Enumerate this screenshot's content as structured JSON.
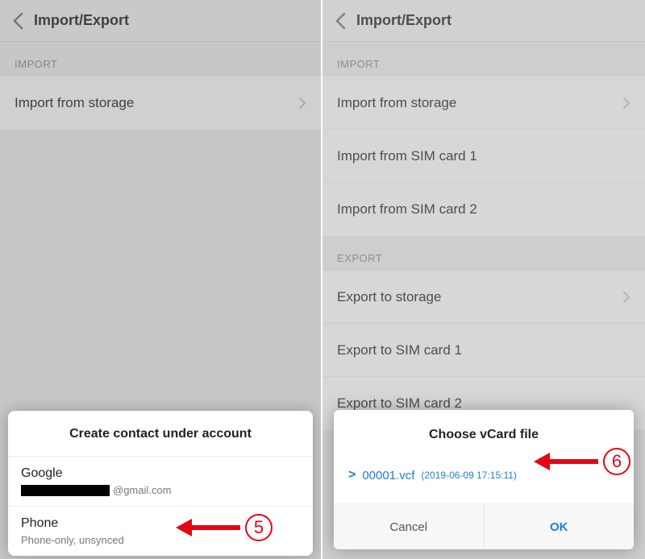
{
  "left": {
    "header": {
      "title": "Import/Export"
    },
    "section_import": "IMPORT",
    "rows": {
      "import_from_storage": "Import from storage"
    },
    "sheet": {
      "title": "Create contact under account",
      "google": {
        "name": "Google",
        "email_suffix": "@gmail.com"
      },
      "phone": {
        "name": "Phone",
        "sub": "Phone-only, unsynced"
      }
    },
    "annotation": {
      "num": "5"
    }
  },
  "right": {
    "header": {
      "title": "Import/Export"
    },
    "section_import": "IMPORT",
    "section_export": "EXPORT",
    "rows": {
      "import_from_storage": "Import from storage",
      "import_sim1": "Import from SIM card 1",
      "import_sim2": "Import from SIM card 2",
      "export_to_storage": "Export to storage",
      "export_sim1": "Export to SIM card 1",
      "export_sim2": "Export to SIM card 2"
    },
    "dialog": {
      "title": "Choose vCard file",
      "file": {
        "name": "00001.vcf",
        "time": "(2019-06-09 17:15:11)"
      },
      "cancel": "Cancel",
      "ok": "OK"
    },
    "annotation": {
      "num": "6"
    }
  },
  "colors": {
    "accent": "#1b7fd4",
    "anno": "#e30613"
  }
}
